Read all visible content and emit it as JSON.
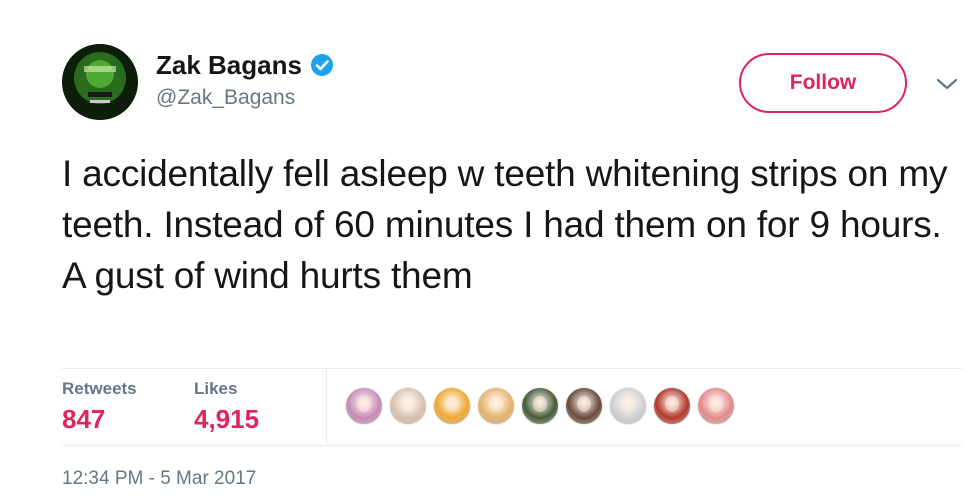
{
  "author": {
    "display_name": "Zak Bagans",
    "handle": "@Zak_Bagans",
    "verified": true,
    "avatar_icon": "zak-bagans-avatar"
  },
  "actions": {
    "follow_label": "Follow",
    "more_icon": "chevron-down-icon"
  },
  "tweet": {
    "text": "I accidentally fell asleep w teeth whitening strips on my teeth. Instead of 60 minutes I had them on for 9 hours. A gust of wind hurts them"
  },
  "stats": {
    "retweets_label": "Retweets",
    "retweets_value": "847",
    "likes_label": "Likes",
    "likes_value": "4,915"
  },
  "likers": [
    {
      "name": "liker-1",
      "color": "#c98bb5"
    },
    {
      "name": "liker-2",
      "color": "#d9c2b0"
    },
    {
      "name": "liker-3",
      "color": "#f0a832"
    },
    {
      "name": "liker-4",
      "color": "#e7b26c"
    },
    {
      "name": "liker-5",
      "color": "#4a5a3a"
    },
    {
      "name": "liker-6",
      "color": "#6b4a3c"
    },
    {
      "name": "liker-7",
      "color": "#d0d0d0"
    },
    {
      "name": "liker-8",
      "color": "#b23a2a"
    },
    {
      "name": "liker-9",
      "color": "#e48a8a"
    }
  ],
  "timestamp": "12:34 PM - 5 Mar 2017",
  "colors": {
    "accent": "#e0245e",
    "verified": "#1da1f2",
    "secondary_text": "#657786",
    "primary_text": "#14171a"
  }
}
